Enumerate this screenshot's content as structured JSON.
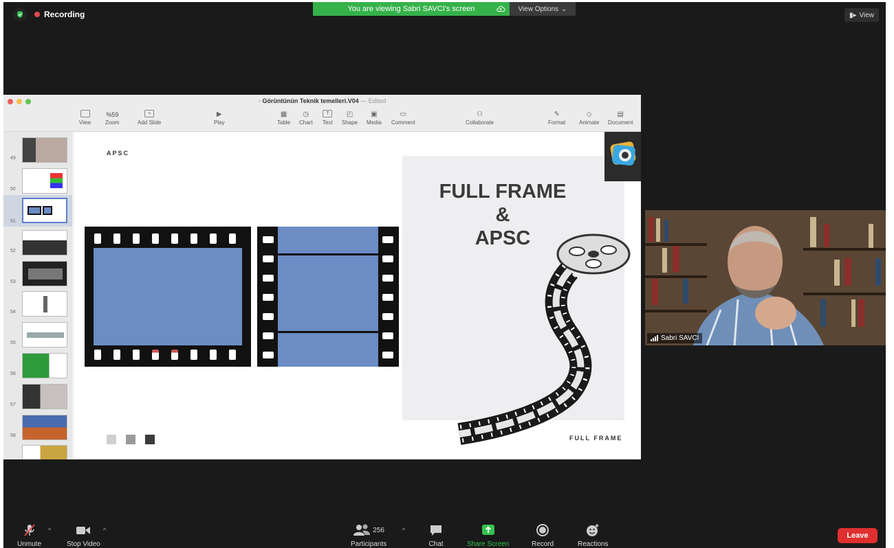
{
  "top_bar": {
    "recording_label": "Recording",
    "banner_text": "You are viewing Sabri SAVCI's screen",
    "view_options_label": "View Options",
    "view_label": "View"
  },
  "keynote": {
    "title": "Görüntünün Teknik temelleri.V04",
    "edited": "Edited",
    "toolbar": {
      "view": "View",
      "zoom_value": "%59",
      "zoom": "Zoom",
      "add_slide": "Add Slide",
      "play": "Play",
      "table": "Table",
      "chart": "Chart",
      "text": "Text",
      "shape": "Shape",
      "media": "Media",
      "comment": "Comment",
      "collaborate": "Collaborate",
      "format": "Format",
      "animate": "Animate",
      "document": "Document"
    },
    "slide_numbers": [
      "49",
      "50",
      "51",
      "52",
      "53",
      "54",
      "55",
      "56",
      "57",
      "58"
    ],
    "selected_slide": "51",
    "slide": {
      "apsc_small": "APSC",
      "title_line1": "FULL FRAME",
      "title_line2": "&",
      "title_line3": "APSC",
      "full_frame_small": "FULL FRAME"
    }
  },
  "participant": {
    "name": "Sabri SAVCI"
  },
  "bottom_bar": {
    "unmute": "Unmute",
    "stop_video": "Stop Video",
    "participants": "Participants",
    "participants_count": "256",
    "chat": "Chat",
    "share_screen": "Share Screen",
    "record": "Record",
    "reactions": "Reactions",
    "leave": "Leave"
  },
  "colors": {
    "banner_green": "#35b24a",
    "leave_red": "#e02f2f",
    "film_blue": "#6b8cc4"
  }
}
